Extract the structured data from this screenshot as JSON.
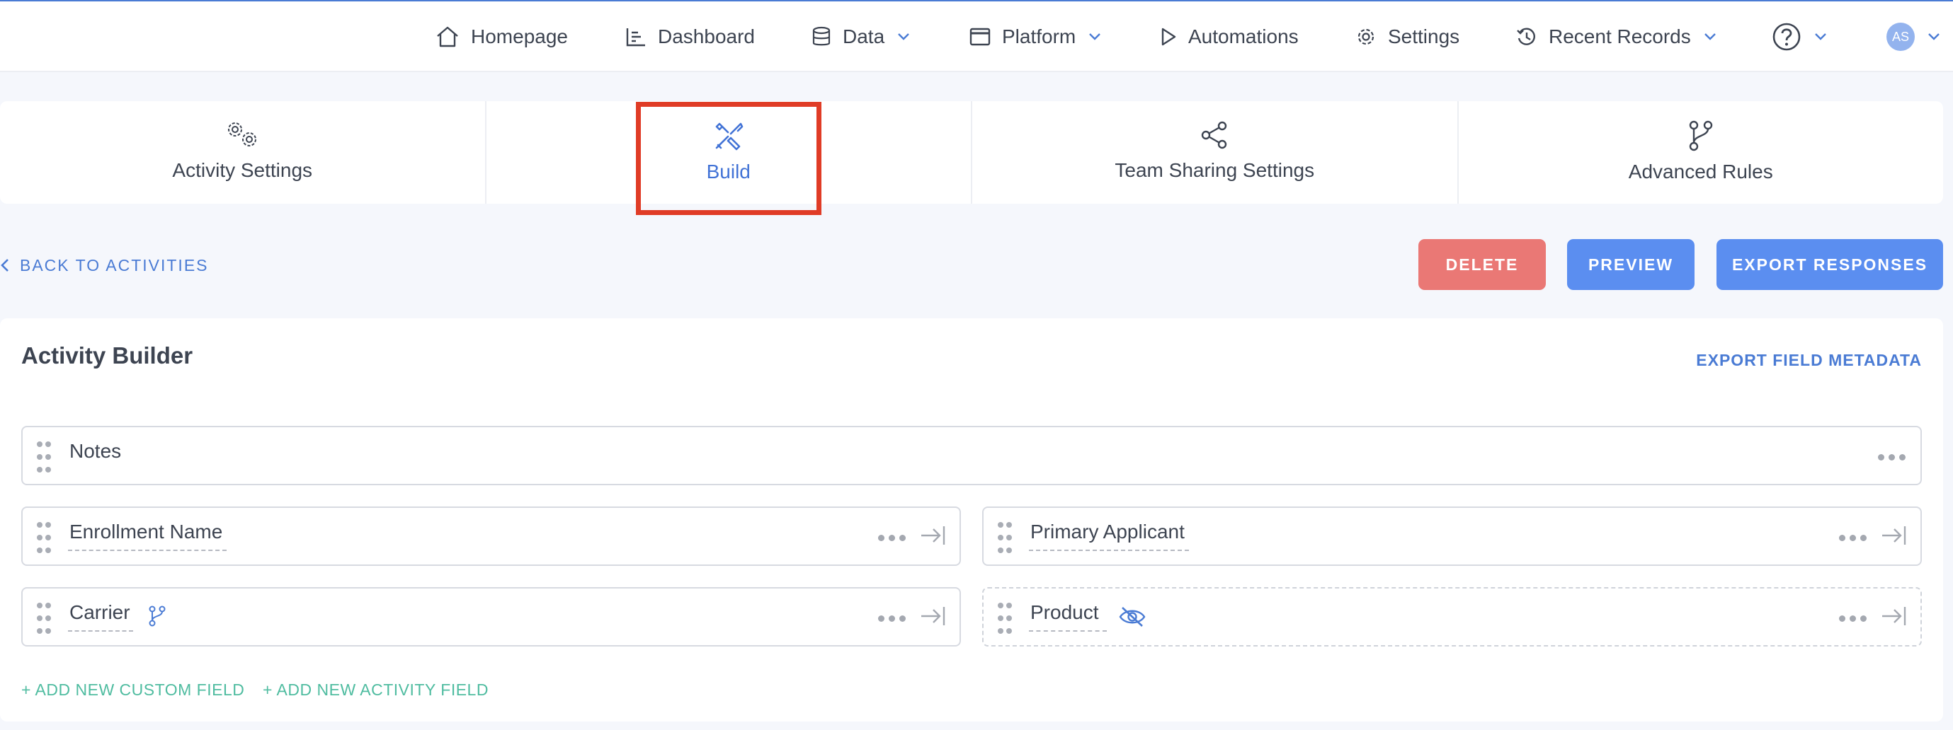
{
  "nav": {
    "homepage": "Homepage",
    "dashboard": "Dashboard",
    "data": "Data",
    "platform": "Platform",
    "automations": "Automations",
    "settings": "Settings",
    "recent_records": "Recent Records",
    "help_icon": "question-circle-icon",
    "avatar_initials": "AS"
  },
  "tabs": [
    {
      "label": "Activity Settings",
      "icon": "gears-icon"
    },
    {
      "label": "Build",
      "icon": "tools-icon",
      "active": true
    },
    {
      "label": "Team Sharing Settings",
      "icon": "share-icon"
    },
    {
      "label": "Advanced Rules",
      "icon": "branch-icon"
    }
  ],
  "actions": {
    "back": "BACK TO ACTIVITIES",
    "delete": "DELETE",
    "preview": "PREVIEW",
    "export_responses": "EXPORT RESPONSES"
  },
  "builder": {
    "title": "Activity Builder",
    "export_metadata": "EXPORT FIELD METADATA",
    "fields": {
      "notes": "Notes",
      "enrollment_name": "Enrollment Name",
      "primary_applicant": "Primary Applicant",
      "carrier": "Carrier",
      "product": "Product"
    },
    "add_custom": "+ ADD NEW CUSTOM FIELD",
    "add_activity": "+ ADD NEW ACTIVITY FIELD"
  },
  "colors": {
    "accent": "#4a7bd4",
    "delete": "#ea7875",
    "primary_button": "#5b8ef0",
    "add_link": "#4fbca0",
    "highlight_box": "#e03c26"
  }
}
